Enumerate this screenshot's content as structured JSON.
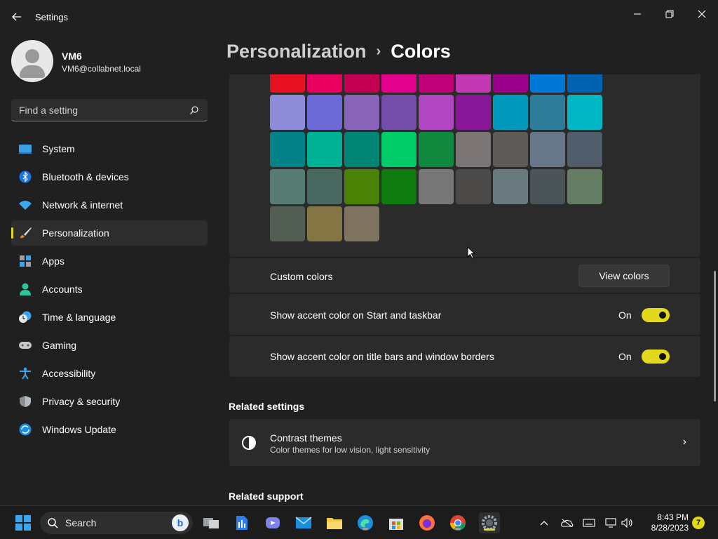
{
  "window": {
    "title": "Settings",
    "back_icon": "back-arrow-icon",
    "controls": [
      "minimize-icon",
      "restore-icon",
      "close-icon"
    ]
  },
  "user": {
    "name": "VM6",
    "email": "VM6@collabnet.local"
  },
  "search": {
    "placeholder": "Find a setting"
  },
  "sidebar": {
    "items": [
      {
        "label": "System",
        "icon": "system-icon",
        "active": false
      },
      {
        "label": "Bluetooth & devices",
        "icon": "bluetooth-icon",
        "active": false
      },
      {
        "label": "Network & internet",
        "icon": "wifi-icon",
        "active": false
      },
      {
        "label": "Personalization",
        "icon": "brush-icon",
        "active": true
      },
      {
        "label": "Apps",
        "icon": "apps-icon",
        "active": false
      },
      {
        "label": "Accounts",
        "icon": "accounts-icon",
        "active": false
      },
      {
        "label": "Time & language",
        "icon": "clock-globe-icon",
        "active": false
      },
      {
        "label": "Gaming",
        "icon": "gamepad-icon",
        "active": false
      },
      {
        "label": "Accessibility",
        "icon": "accessibility-icon",
        "active": false
      },
      {
        "label": "Privacy & security",
        "icon": "shield-icon",
        "active": false
      },
      {
        "label": "Windows Update",
        "icon": "update-icon",
        "active": false
      }
    ],
    "accent": "#e3d81c"
  },
  "header": {
    "parent": "Personalization",
    "separator": "›",
    "current": "Colors"
  },
  "swatches": {
    "rows": [
      [
        "#e81123",
        "#ea005e",
        "#c30052",
        "#e3008c",
        "#bf0077",
        "#c239b3",
        "#9a0089",
        "#0078d7",
        "#0063b1"
      ],
      [
        "#8e8cd8",
        "#6b69d6",
        "#8764b8",
        "#744da9",
        "#b146c2",
        "#881798",
        "#0099bc",
        "#2d7d9a",
        "#00b7c3"
      ],
      [
        "#038387",
        "#00b294",
        "#018574",
        "#00cc6a",
        "#10893e",
        "#7a7574",
        "#5d5a58",
        "#68768a",
        "#515c6b"
      ],
      [
        "#567c73",
        "#486860",
        "#498205",
        "#107c10",
        "#767676",
        "#4c4a48",
        "#69797e",
        "#4a5459",
        "#647c64"
      ],
      [
        "#525e54",
        "#847545",
        "#7e735f"
      ]
    ]
  },
  "custom_colors": {
    "label": "Custom colors",
    "button": "View colors"
  },
  "toggles": [
    {
      "label": "Show accent color on Start and taskbar",
      "state": "On"
    },
    {
      "label": "Show accent color on title bars and window borders",
      "state": "On"
    }
  ],
  "related_settings": {
    "heading": "Related settings",
    "items": [
      {
        "title": "Contrast themes",
        "subtitle": "Color themes for low vision, light sensitivity",
        "icon": "contrast-icon"
      }
    ]
  },
  "related_support": {
    "heading": "Related support"
  },
  "taskbar": {
    "search_label": "Search",
    "apps": [
      "start-icon",
      "task-view-icon",
      "file-icon",
      "teams-icon",
      "mail-icon",
      "file-explorer-icon",
      "edge-icon",
      "store-icon",
      "firefox-icon",
      "chrome-icon",
      "settings-icon"
    ],
    "time": "8:43 PM",
    "date": "8/28/2023",
    "notification_count": "7"
  }
}
